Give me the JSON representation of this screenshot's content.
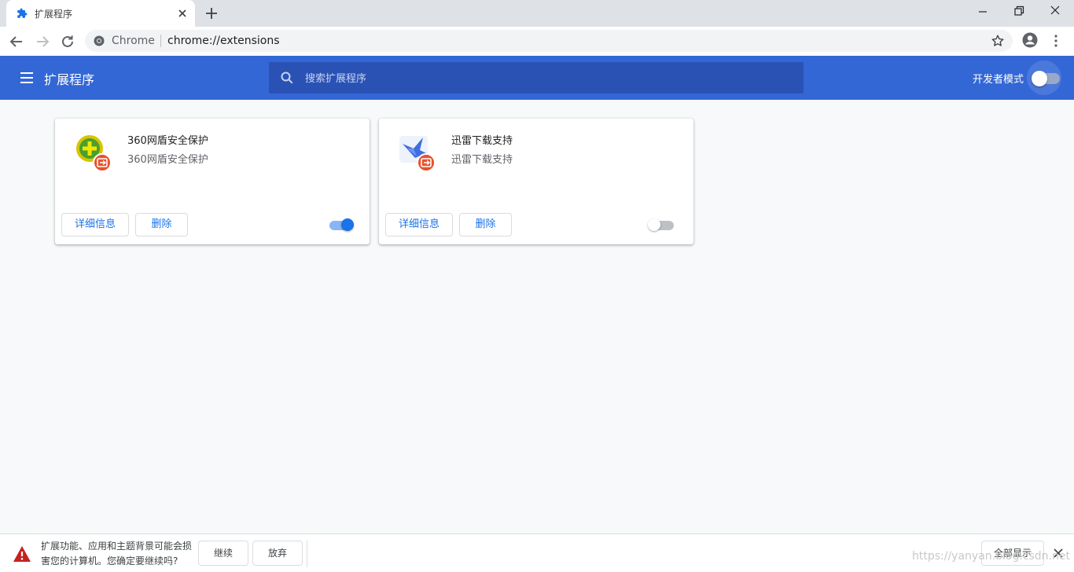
{
  "browser": {
    "tab_title": "扩展程序",
    "omnibox_scheme": "Chrome",
    "omnibox_url": "chrome://extensions"
  },
  "header": {
    "title": "扩展程序",
    "search_placeholder": "搜索扩展程序",
    "dev_mode_label": "开发者模式",
    "dev_mode_enabled": false
  },
  "extensions": [
    {
      "name": "360网盾安全保护",
      "description": "360网盾安全保护",
      "details_label": "详细信息",
      "remove_label": "删除",
      "enabled": true,
      "icon": "360-shield-icon"
    },
    {
      "name": "迅雷下载支持",
      "description": "迅雷下载支持",
      "details_label": "详细信息",
      "remove_label": "删除",
      "enabled": false,
      "icon": "thunder-bird-icon"
    }
  ],
  "warning_bar": {
    "message": "扩展功能、应用和主题背景可能会损害您的计算机。您确定要继续吗?",
    "continue_label": "继续",
    "discard_label": "放弃",
    "show_all_label": "全部显示"
  },
  "watermark": "https://yanyan.blog.csdn.net",
  "colors": {
    "header_blue": "#3367d6",
    "search_blue": "#2a52b5",
    "accent_blue": "#1a73e8",
    "badge_orange": "#e8512d"
  }
}
